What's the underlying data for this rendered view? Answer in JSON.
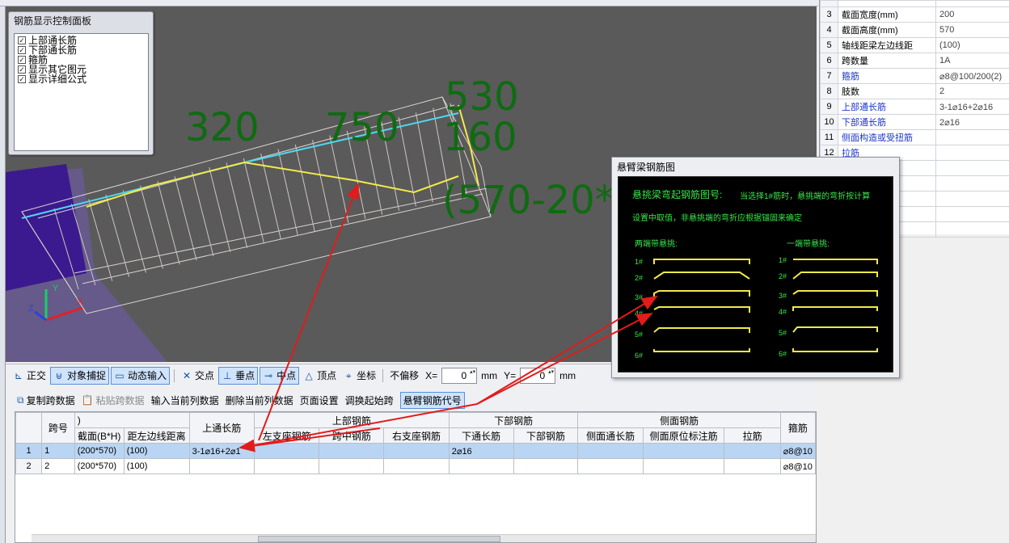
{
  "control_panel": {
    "title": "钢筋显示控制面板",
    "options": [
      {
        "label": "上部通长筋",
        "checked": true
      },
      {
        "label": "下部通长筋",
        "checked": true
      },
      {
        "label": "箍筋",
        "checked": true
      },
      {
        "label": "显示其它图元",
        "checked": true
      },
      {
        "label": "显示详细公式",
        "checked": true
      }
    ]
  },
  "viewport": {
    "dim_labels": [
      "320",
      "750",
      "530",
      "160",
      "(570-20*"
    ],
    "axis_y": "Y",
    "axis_x": "X",
    "axis_z": "Z"
  },
  "snap_toolbar": {
    "ortho": "正交",
    "object_snap": "对象捕捉",
    "dynamic_input": "动态输入",
    "intersection": "交点",
    "perpendicular": "垂点",
    "midpoint": "中点",
    "vertex": "顶点",
    "coordinate": "坐标",
    "offset_mode": "不偏移",
    "x_label": "X=",
    "x_value": "0",
    "x_unit": "mm",
    "y_label": "Y=",
    "y_value": "0",
    "y_unit": "mm"
  },
  "grid_toolbar": {
    "copy": "复制跨数据",
    "paste": "粘贴跨数据",
    "input_col": "输入当前列数据",
    "delete_col": "删除当前列数据",
    "page_setup": "页面设置",
    "swap_start": "调换起始跨",
    "cantilever_code": "悬臂钢筋代号"
  },
  "grid": {
    "headers": {
      "span_no": "跨号",
      "group_prefix": ")",
      "section": "截面(B*H)",
      "axis_dist": "距左边线距离",
      "top_through": "上通长筋",
      "top_rebar": "上部钢筋",
      "left_support": "左支座钢筋",
      "mid_span": "跨中钢筋",
      "right_support": "右支座钢筋",
      "bottom_rebar": "下部钢筋",
      "bottom_through": "下通长筋",
      "bottom_bars": "下部钢筋",
      "side_rebar": "侧面钢筋",
      "side_through": "侧面通长筋",
      "side_in_situ": "侧面原位标注筋",
      "tie": "拉筋",
      "stirrup": "箍筋"
    },
    "rows": [
      {
        "idx": "1",
        "span": "1",
        "section": "(200*570)",
        "dist": "(100)",
        "top_through": "3-1⌀16+2⌀1",
        "bottom_through": "2⌀16",
        "stirrup": "⌀8@10"
      },
      {
        "idx": "2",
        "span": "2",
        "section": "(200*570)",
        "dist": "(100)",
        "top_through": "",
        "bottom_through": "",
        "stirrup": "⌀8@10"
      }
    ]
  },
  "properties": {
    "rows": [
      {
        "n": "3",
        "key": "截面宽度(mm)",
        "val": "200",
        "blue": false
      },
      {
        "n": "4",
        "key": "截面高度(mm)",
        "val": "570",
        "blue": false
      },
      {
        "n": "5",
        "key": "轴线距梁左边线距",
        "val": "(100)",
        "blue": false
      },
      {
        "n": "6",
        "key": "跨数量",
        "val": "1A",
        "blue": false
      },
      {
        "n": "7",
        "key": "箍筋",
        "val": "⌀8@100/200(2)",
        "blue": true
      },
      {
        "n": "8",
        "key": "肢数",
        "val": "2",
        "blue": false
      },
      {
        "n": "9",
        "key": "上部通长筋",
        "val": "3-1⌀16+2⌀16",
        "blue": true
      },
      {
        "n": "10",
        "key": "下部通长筋",
        "val": "2⌀16",
        "blue": true
      },
      {
        "n": "11",
        "key": "侧面构造或受扭筋",
        "val": "",
        "blue": true
      },
      {
        "n": "12",
        "key": "拉筋",
        "val": "",
        "blue": true
      }
    ]
  },
  "popup": {
    "title": "悬臂梁钢筋图",
    "heading": "悬挑梁弯起钢筋图号:",
    "note1": "当选择1#筋时，悬挑端的弯折按计算",
    "note2": "设置中取值，非悬挑端的弯折应根据锚固来确定",
    "both_ends": "两端带悬挑:",
    "one_end": "一端带悬挑:",
    "labels": [
      "1#",
      "2#",
      "3#",
      "4#",
      "5#",
      "6#"
    ]
  },
  "colors": {
    "viewport_bg": "#5a5a5a",
    "dim_text": "#0f6b12",
    "popup_text": "#39e64a",
    "rebar_yellow": "#f2ea4a",
    "arrow_red": "#e21b1b",
    "selection": "#b9d5f3"
  }
}
